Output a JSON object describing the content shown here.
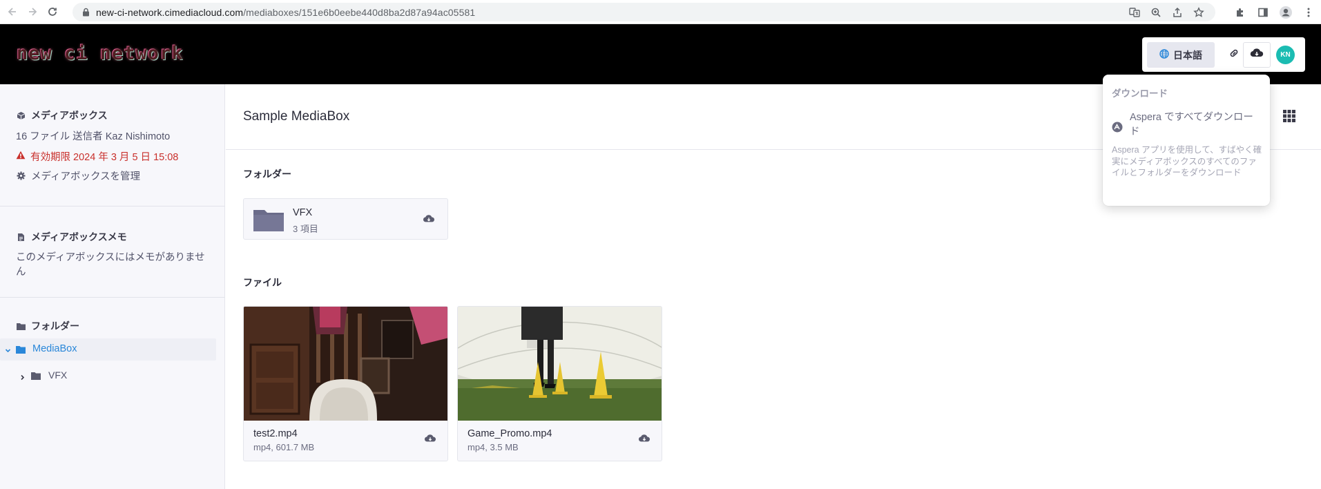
{
  "browser": {
    "url_host": "new-ci-network.cimediacloud.com",
    "url_path": "/mediaboxes/151e6b0eebe440d8ba2d87a94ac05581"
  },
  "header": {
    "logo_text": "new ci network",
    "language_label": "日本語",
    "avatar_initials": "KN"
  },
  "sidebar": {
    "mediabox_heading": "メディアボックス",
    "file_info": "16 ファイル 送信者 Kaz Nishimoto",
    "expiry": "有効期限 2024 年 3 月 5 日 15:08",
    "manage_label": "メディアボックスを管理",
    "memo_heading": "メディアボックスメモ",
    "memo_text": "このメディアボックスにはメモがありません",
    "folders_heading": "フォルダー",
    "tree": [
      {
        "label": "MediaBox"
      },
      {
        "label": "VFX"
      }
    ]
  },
  "main": {
    "title": "Sample MediaBox",
    "folders_label": "フォルダー",
    "files_label": "ファイル",
    "folders": [
      {
        "name": "VFX",
        "count": "3 項目"
      }
    ],
    "files": [
      {
        "name": "test2.mp4",
        "meta": "mp4, 601.7 MB"
      },
      {
        "name": "Game_Promo.mp4",
        "meta": "mp4, 3.5 MB"
      }
    ]
  },
  "download_menu": {
    "heading": "ダウンロード",
    "item_label": "Aspera ですべてダウンロード",
    "item_description": "Aspera アプリを使用して、すばやく確実にメディアボックスのすべてのファイルとフォルダーをダウンロード"
  },
  "colors": {
    "accent_blue": "#2a87d9",
    "danger": "#c9302c",
    "avatar_teal": "#1bbcb2"
  }
}
